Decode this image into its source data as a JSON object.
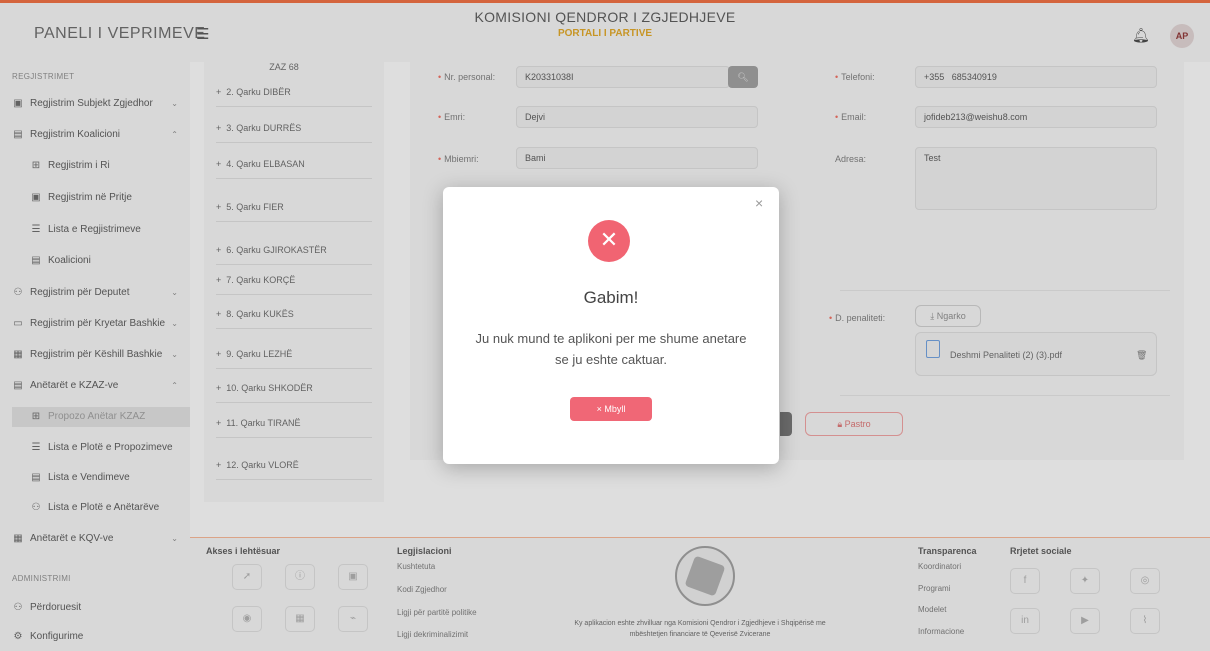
{
  "header": {
    "brand": "PANELI I VEPRIMEVE",
    "menu_icon": "menu-icon",
    "title": "KOMISIONI QENDROR I ZGJEDHJEVE",
    "subtitle": "PORTALI I PARTIVE",
    "avatar": "AP"
  },
  "sidebar": {
    "sections": [
      {
        "label": "REGJISTRIMET"
      },
      {
        "label": "ADMINISTRIMI"
      }
    ],
    "items": [
      {
        "label": "Regjistrim Subjekt Zgjedhor",
        "icon": "▣",
        "arrow": "⌄"
      },
      {
        "label": "Regjistrim Koalicioni",
        "icon": "▤",
        "arrow": "⌃"
      },
      {
        "label": "Regjistrim i Ri",
        "icon": "⊞"
      },
      {
        "label": "Regjistrim në Pritje",
        "icon": "▣"
      },
      {
        "label": "Lista e Regjistrimeve",
        "icon": "☰"
      },
      {
        "label": "Koalicioni",
        "icon": "▤"
      },
      {
        "label": "Regjistrim për Deputet",
        "icon": "⚇",
        "arrow": "⌄"
      },
      {
        "label": "Regjistrim për Kryetar Bashkie",
        "icon": "▭",
        "arrow": "⌄"
      },
      {
        "label": "Regjistrim për Këshill Bashkie",
        "icon": "▦",
        "arrow": "⌄"
      },
      {
        "label": "Anëtarët e KZAZ-ve",
        "icon": "▤",
        "arrow": "⌃"
      },
      {
        "label": "Propozo Anëtar KZAZ",
        "icon": "⊞"
      },
      {
        "label": "Lista e Plotë e Propozimeve",
        "icon": "☰"
      },
      {
        "label": "Lista e Vendimeve",
        "icon": "▤"
      },
      {
        "label": "Lista e Plotë e Anëtarëve",
        "icon": "⚇"
      },
      {
        "label": "Anëtarët e KQV-ve",
        "icon": "▦",
        "arrow": "⌄"
      },
      {
        "label": "Përdoruesit",
        "icon": "⚇"
      },
      {
        "label": "Konfigurime",
        "icon": "⚙"
      }
    ]
  },
  "qarqe": {
    "first": "ZAZ 68",
    "items": [
      "2. Qarku DIBËR",
      "3. Qarku DURRËS",
      "4. Qarku ELBASAN",
      "5. Qarku FIER",
      "6. Qarku GJIROKASTËR",
      "7. Qarku KORÇË",
      "8. Qarku KUKËS",
      "9. Qarku LEZHË",
      "10. Qarku SHKODËR",
      "11. Qarku TIRANË",
      "12. Qarku VLORË"
    ]
  },
  "form": {
    "nr_personal_label": "Nr. personal:",
    "nr_personal_value": "K20331038I",
    "emri_label": "Emri:",
    "emri_value": "Dejvi",
    "mbiemri_label": "Mbiemri:",
    "mbiemri_value": "Bami",
    "telefoni_label": "Telefoni:",
    "telefoni_prefix": "+355",
    "telefoni_value": "685340919",
    "email_label": "Email:",
    "email_value": "jofideb213@weishu8.com",
    "adresa_label": "Adresa:",
    "adresa_value": "Test",
    "penaliteti_label": "D. penaliteti:",
    "upload_label": "Ngarko",
    "file_name": "Deshmi Penaliteti (2) (3).pdf",
    "clear_label": "Pastro"
  },
  "modal": {
    "title": "Gabim!",
    "message": "Ju nuk mund te aplikoni per me shume anetare se ju eshte caktuar.",
    "button": "Mbyll"
  },
  "footer": {
    "access_title": "Akses i lehtësuar",
    "legislation_title": "Legjislacioni",
    "legislation_links": [
      "Kushtetuta",
      "Kodi Zgjedhor",
      "Ligji për partitë politike",
      "Ligji dekriminalizimit"
    ],
    "credit_line1": "Ky aplikacion eshte zhvilluar nga Komisioni Qendror i Zgjedhjeve i Shqipërisë me",
    "credit_line2": "mbështetjen financiare të Qeverisë Zvicerane",
    "transparency_title": "Transparenca",
    "transparency_links": [
      "Koordinatori",
      "Programi",
      "Modelet",
      "Informacione"
    ],
    "social_title": "Rrjetet sociale"
  },
  "colors": {
    "accent": "#e8683c",
    "error": "#f16472",
    "gold": "#d9a020"
  }
}
